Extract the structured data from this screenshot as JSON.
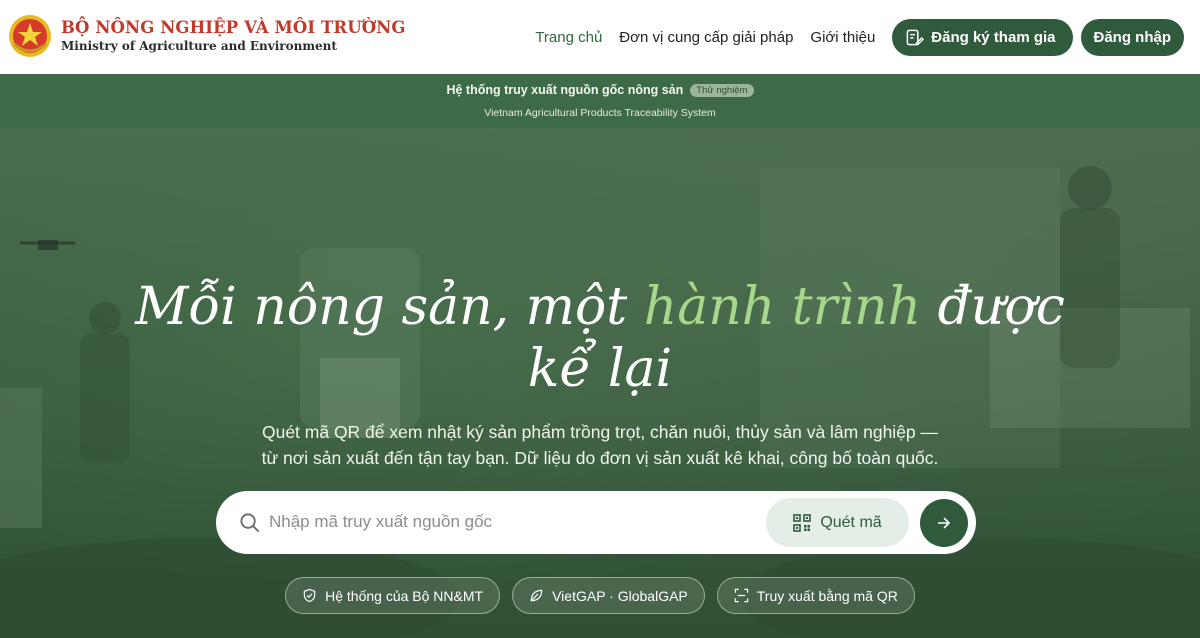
{
  "header": {
    "brand_title": "BỘ NÔNG NGHIỆP VÀ MÔI TRƯỜNG",
    "brand_subtitle": "Ministry of Agriculture and Environment",
    "nav": [
      "Trang chủ",
      "Đơn vị cung cấp giải pháp",
      "Giới thiệu"
    ],
    "register_label": "Đăng ký tham gia",
    "login_label": "Đăng nhập"
  },
  "banner": {
    "title": "Hệ thống truy xuất nguồn gốc nông sản",
    "badge": "Thử nghiệm",
    "subtitle": "Vietnam Agricultural Products Traceability System"
  },
  "hero": {
    "title_part1": "Mỗi nông sản, một ",
    "title_highlight": "hành trình",
    "title_part2": " được",
    "title_line2": "kể lại",
    "desc_line1": "Quét mã QR để xem nhật ký sản phẩm trồng trọt, chăn nuôi, thủy sản và lâm nghiệp —",
    "desc_line2": "từ nơi sản xuất đến tận tay bạn. Dữ liệu do đơn vị sản xuất kê khai, công bố toàn quốc."
  },
  "search": {
    "placeholder": "Nhập mã truy xuất nguồn gốc",
    "value": "",
    "scan_label": "Quét mã"
  },
  "chips": [
    "Hệ thống của Bộ NN&MT",
    "VietGAP · GlobalGAP",
    "Truy xuất bằng mã QR"
  ],
  "colors": {
    "brand_red": "#c0392b",
    "primary_green": "#2f5a3b",
    "banner_green": "#3e6b47",
    "highlight_green": "#a6d88c"
  },
  "icons": {
    "emblem": "national-emblem-icon",
    "register": "edit-form-icon",
    "search": "search-icon",
    "scan": "qr-code-icon",
    "go": "arrow-right-icon",
    "chip_0": "shield-check-icon",
    "chip_1": "leaf-icon",
    "chip_2": "scan-frame-icon"
  }
}
